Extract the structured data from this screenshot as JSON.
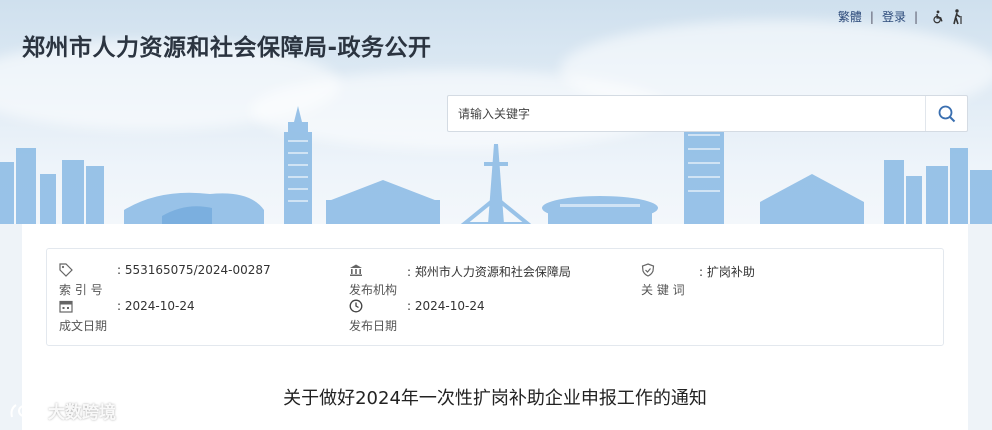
{
  "header": {
    "title": "郑州市人力资源和社会保障局-政务公开",
    "links": {
      "traditional": "繁體",
      "login": "登录"
    },
    "icons": {
      "accessibility": "wheelchair-icon",
      "elderly": "elderly-icon"
    }
  },
  "search": {
    "placeholder": "请输入关键字",
    "icon": "search-icon"
  },
  "meta": {
    "index_no": {
      "label": "索 引 号",
      "value": ": 553165075/2024-00287",
      "icon": "tag-icon"
    },
    "publisher": {
      "label": "发布机构",
      "value": ": 郑州市人力资源和社会保障局",
      "icon": "institution-icon"
    },
    "keywords": {
      "label": "关 键 词",
      "value": ": 扩岗补助",
      "icon": "shield-check-icon"
    },
    "created_date": {
      "label": "成文日期",
      "value": ": 2024-10-24",
      "icon": "calendar-icon"
    },
    "publish_date": {
      "label": "发布日期",
      "value": ": 2024-10-24",
      "icon": "clock-icon"
    }
  },
  "document": {
    "title": "关于做好2024年一次性扩岗补助企业申报工作的通知"
  },
  "watermark": {
    "text": "大数跨境"
  },
  "colors": {
    "banner_sky": "#cfe0ee",
    "skyline": "#8fbde6",
    "link": "#2c4a7a",
    "search_icon": "#3a6fb0"
  }
}
